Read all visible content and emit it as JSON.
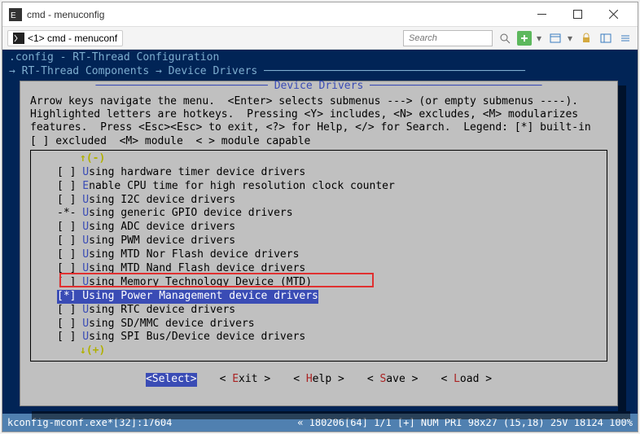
{
  "window": {
    "title": "cmd - menuconfig"
  },
  "tab": {
    "label": "<1> cmd - menuconf"
  },
  "toolbar": {
    "search_placeholder": "Search"
  },
  "header": {
    "line1": ".config - RT-Thread Configuration",
    "line2": " → RT-Thread Components → Device Drivers ─────────────────────────────────────────"
  },
  "box": {
    "title": "Device Drivers",
    "help1": "Arrow keys navigate the menu.  <Enter> selects submenus ---> (or empty submenus ----).",
    "help2": "Highlighted letters are hotkeys.  Pressing <Y> includes, <N> excludes, <M> modularizes",
    "help3": "features.  Press <Esc><Esc> to exit, <?> for Help, </> for Search.  Legend: [*] built-in",
    "help4": "[ ] excluded  <M> module  < > module capable",
    "scroll_up": "↑(-)",
    "scroll_down": "↓(+)"
  },
  "items": [
    {
      "box": "[ ]",
      "hot": "U",
      "rest": "sing hardware timer device drivers"
    },
    {
      "box": "[ ]",
      "hot": "E",
      "rest": "nable CPU time for high resolution clock counter"
    },
    {
      "box": "[ ]",
      "hot": "U",
      "rest": "sing I2C device drivers"
    },
    {
      "box": "-*-",
      "hot": "U",
      "rest": "sing generic GPIO device drivers"
    },
    {
      "box": "[ ]",
      "hot": "U",
      "rest": "sing ADC device drivers"
    },
    {
      "box": "[ ]",
      "hot": "U",
      "rest": "sing PWM device drivers"
    },
    {
      "box": "[ ]",
      "hot": "U",
      "rest": "sing MTD Nor Flash device drivers"
    },
    {
      "box": "[ ]",
      "hot": "U",
      "rest": "sing MTD Nand Flash device drivers"
    },
    {
      "box": "[ ]",
      "hot": "U",
      "rest": "sing Memory Technology Device (MTD)"
    },
    {
      "box": "[*]",
      "hot": "U",
      "rest": "sing Power Management device drivers"
    },
    {
      "box": "[ ]",
      "hot": "U",
      "rest": "sing RTC device drivers"
    },
    {
      "box": "[ ]",
      "hot": "U",
      "rest": "sing SD/MMC device drivers"
    },
    {
      "box": "[ ]",
      "hot": "U",
      "rest": "sing SPI Bus/Device device drivers"
    }
  ],
  "selected_index": 9,
  "buttons": {
    "select": "Select",
    "exit": "xit",
    "exit_hot": "E",
    "help": "elp",
    "help_hot": "H",
    "save": "ave",
    "save_hot": "S",
    "load": "oad",
    "load_hot": "L"
  },
  "status": {
    "left": "kconfig-mconf.exe*[32]:17604",
    "right": "« 180206[64]  1/1  [+] NUM  PRI   98x27  (15,18) 25V  18124 100%"
  }
}
